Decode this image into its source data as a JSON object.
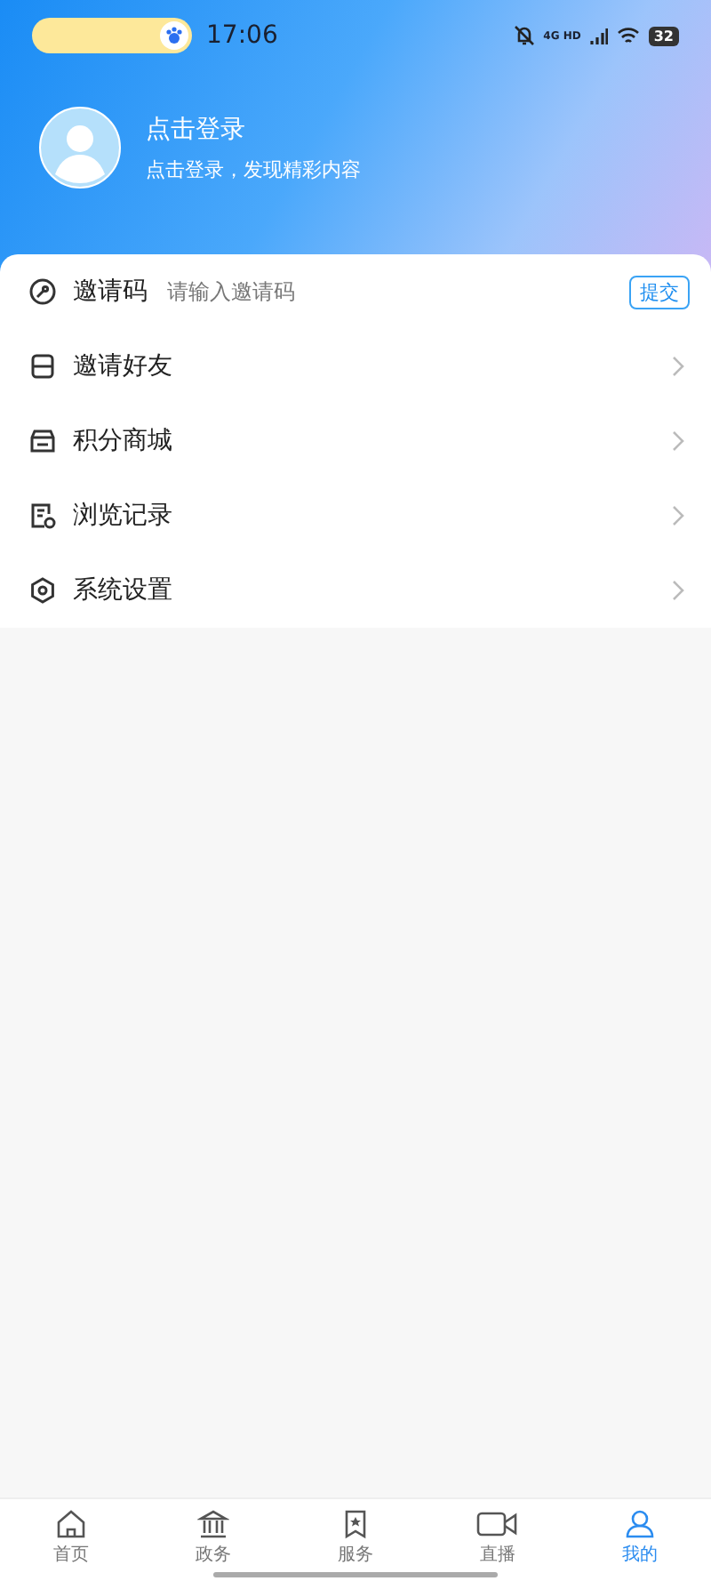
{
  "status_bar": {
    "time": "17:06",
    "network": "4G HD",
    "battery": "32"
  },
  "profile": {
    "title": "点击登录",
    "subtitle": "点击登录，发现精彩内容"
  },
  "menu": [
    {
      "kind": "input",
      "label": "邀请码",
      "placeholder": "请输入邀请码",
      "button": "提交"
    },
    {
      "kind": "link",
      "label": "邀请好友"
    },
    {
      "kind": "link",
      "label": "积分商城"
    },
    {
      "kind": "link",
      "label": "浏览记录"
    },
    {
      "kind": "link",
      "label": "系统设置"
    }
  ],
  "tabs": [
    {
      "label": "首页",
      "selected": false
    },
    {
      "label": "政务",
      "selected": false
    },
    {
      "label": "服务",
      "selected": false
    },
    {
      "label": "直播",
      "selected": false
    },
    {
      "label": "我的",
      "selected": true
    }
  ]
}
